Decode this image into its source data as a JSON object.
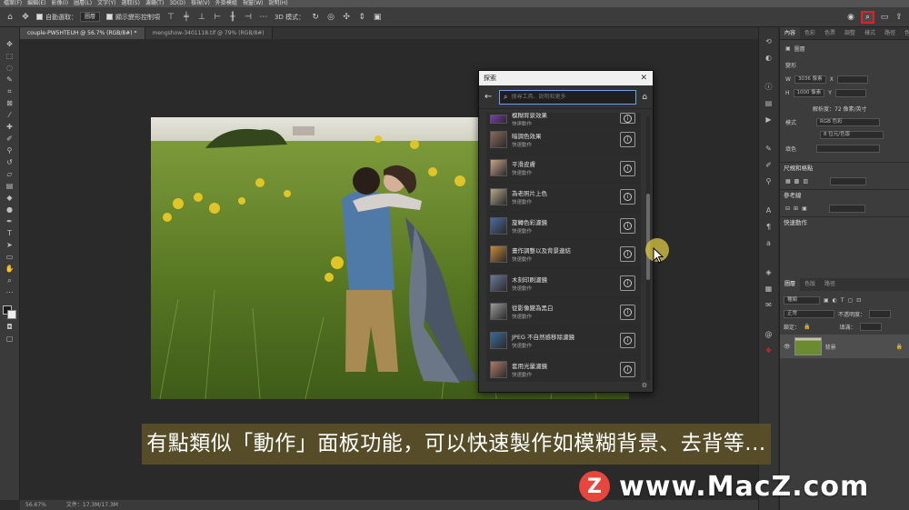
{
  "menubar": {
    "items": [
      "檔案(F)",
      "編輯(E)",
      "影像(I)",
      "圖層(L)",
      "文字(Y)",
      "選取(S)",
      "濾鏡(T)",
      "3D(D)",
      "檢視(V)",
      "外掛模組",
      "視窗(W)",
      "說明(H)"
    ]
  },
  "options": {
    "auto_select_label": "自動選取：",
    "auto_select_value": "圖層",
    "show_transform_label": "顯示變形控制項",
    "mode_3d_label": "3D 模式："
  },
  "tabs": [
    {
      "label": "couple-PW5HTEUH @ 56.7% (RGB/8#) *"
    },
    {
      "label": "mengshow-3401118.tif @ 79% (RGB/8#)"
    }
  ],
  "status": {
    "zoom": "56.67%",
    "doc": "文件：17.3M/17.3M"
  },
  "right_panel": {
    "tabs": [
      "內容",
      "色彩",
      "色票",
      "調整",
      "樣式",
      "路徑",
      "色板"
    ],
    "layer_label": "圖層",
    "transform_heading": "變形",
    "w_label": "W",
    "w_value": "3036 像素",
    "h_label": "H",
    "h_value": "1000 像素",
    "x_label": "X",
    "y_label": "Y",
    "resolution": "解析度：72 像素/英寸",
    "mode_label": "模式",
    "mode_value": "RGB 色彩",
    "depth_value": "8 位元/色版",
    "fill_label": "填色",
    "canvas_heading": "尺規和格點",
    "guides_heading": "參考線",
    "quick_actions_heading": "快速動作",
    "layers_tabs": [
      "圖層",
      "色版",
      "路徑"
    ],
    "layer_kind": "種類",
    "layer_blend": "正常",
    "layer_opacity": "不透明度：",
    "layer_lock": "鎖定：",
    "layer_fill": "填滿：",
    "layer_name": "背景"
  },
  "dialog": {
    "title": "探索",
    "search_placeholder": "搜尋工具、說明和更多",
    "items": [
      {
        "name": "模糊背景效果",
        "type": "快速動作",
        "color": "#7a3bb8"
      },
      {
        "name": "暗調色效果",
        "type": "快速動作",
        "color": "#8a6a5a"
      },
      {
        "name": "平滑皮膚",
        "type": "快速動作",
        "color": "#c9a48a"
      },
      {
        "name": "為老照片上色",
        "type": "快速動作",
        "color": "#b8a888"
      },
      {
        "name": "旋轉色彩濾鏡",
        "type": "快速動作",
        "color": "#4a6aa0"
      },
      {
        "name": "畫作調整以及背景連結",
        "type": "快速動作",
        "color": "#c88a3a"
      },
      {
        "name": "木刻印刷濾鏡",
        "type": "快速動作",
        "color": "#6a7a9a"
      },
      {
        "name": "從影像變為黑白",
        "type": "快速動作",
        "color": "#9a9a9a"
      },
      {
        "name": "JPEG 不自然感移除濾鏡",
        "type": "快速動作",
        "color": "#3a6a9a"
      },
      {
        "name": "套用光量濾鏡",
        "type": "快速動作",
        "color": "#b07a6a"
      }
    ]
  },
  "subtitle": "有點類似「動作」面板功能，可以快速製作如模糊背景、去背等...",
  "watermark": {
    "logo": "Z",
    "text": "www.MacZ.com"
  },
  "colors": {
    "accent": "#e0202a",
    "subtitle_bg": "#5a5028",
    "watermark_logo": "#e8453c"
  }
}
